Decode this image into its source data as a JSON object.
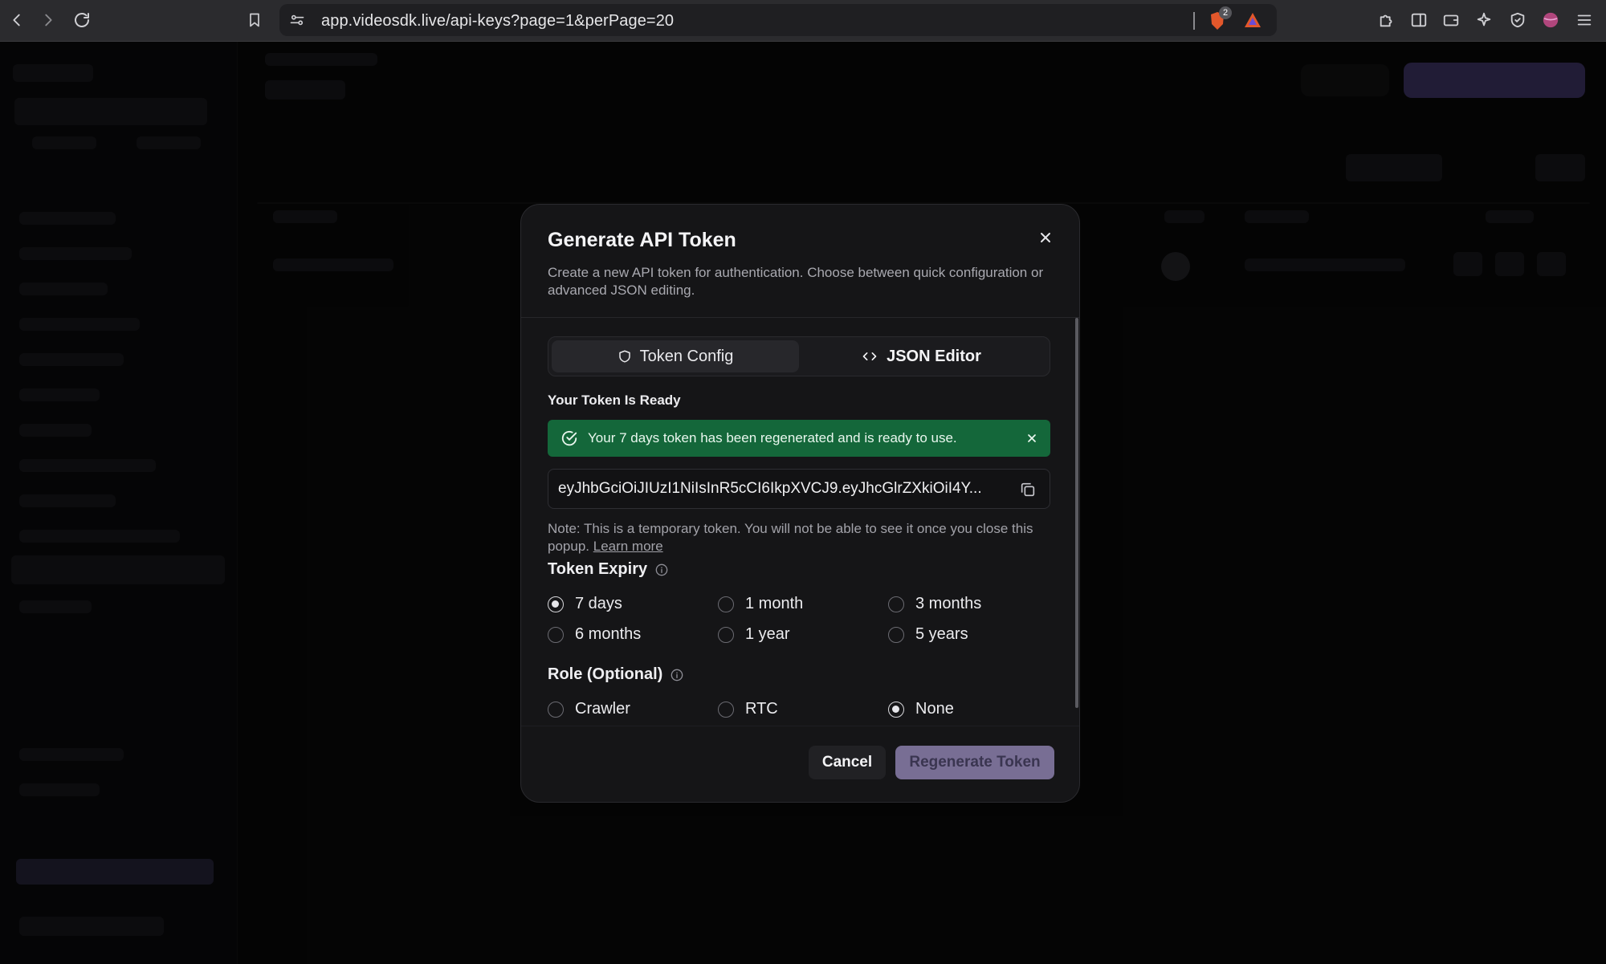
{
  "browser": {
    "url": "app.videosdk.live/api-keys?page=1&perPage=20",
    "brave_badge_count": "2"
  },
  "modal": {
    "title": "Generate API Token",
    "description": "Create a new API token for authentication. Choose between quick configuration or advanced JSON editing.",
    "tabs": [
      {
        "label": "Token Config",
        "icon": "shield-icon",
        "active": true
      },
      {
        "label": "JSON Editor",
        "icon": "code-icon",
        "active": false
      }
    ],
    "ready_label": "Your Token Is Ready",
    "alert_text": "Your 7 days token has been regenerated and is ready to use.",
    "token_value": "eyJhbGciOiJIUzI1NiIsInR5cCI6IkpXVCJ9.eyJhcGlrZXkiOiI4Y...",
    "note_text": "Note: This is a temporary token. You will not be able to see it once you close this popup.",
    "note_link": "Learn more",
    "expiry": {
      "title": "Token Expiry",
      "options": [
        "7 days",
        "1 month",
        "3 months",
        "6 months",
        "1 year",
        "5 years"
      ],
      "selected": "7 days"
    },
    "role": {
      "title": "Role (Optional)",
      "options": [
        "Crawler",
        "RTC",
        "None"
      ],
      "selected": "None"
    },
    "cancel_label": "Cancel",
    "regenerate_label": "Regenerate Token"
  },
  "colors": {
    "alert_green": "#14673a",
    "primary_button": "#786e94"
  }
}
